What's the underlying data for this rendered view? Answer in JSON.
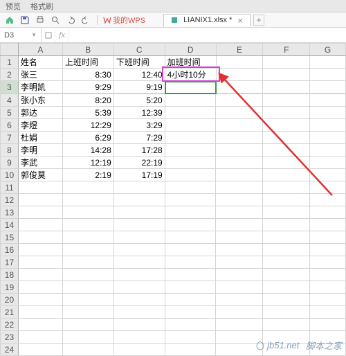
{
  "menubar": {
    "item1": "预览",
    "item2": "格式刷"
  },
  "wps": {
    "label": "我的WPS"
  },
  "file_tab": {
    "name": "LIANIX1.xlsx *"
  },
  "name_box": {
    "value": "D3"
  },
  "formula_input": {
    "value": ""
  },
  "columns": [
    "A",
    "B",
    "C",
    "D",
    "E",
    "F",
    "G"
  ],
  "header_row": {
    "a": "姓名",
    "b": "上班时间",
    "c": "下班时间",
    "d": "加班时间"
  },
  "rows": [
    {
      "n": "1"
    },
    {
      "n": "2",
      "a": "张三",
      "b": "8:30",
      "c": "12:40",
      "d": "4小时10分"
    },
    {
      "n": "3",
      "a": "李明凯",
      "b": "9:29",
      "c": "9:19"
    },
    {
      "n": "4",
      "a": "张小东",
      "b": "8:20",
      "c": "5:20"
    },
    {
      "n": "5",
      "a": "郭达",
      "b": "5:39",
      "c": "12:39"
    },
    {
      "n": "6",
      "a": "李煜",
      "b": "12:29",
      "c": "3:29"
    },
    {
      "n": "7",
      "a": "杜娟",
      "b": "6:29",
      "c": "7:29"
    },
    {
      "n": "8",
      "a": "李明",
      "b": "14:28",
      "c": "17:28"
    },
    {
      "n": "9",
      "a": "李武",
      "b": "12:19",
      "c": "22:19"
    },
    {
      "n": "10",
      "a": "郭俊莫",
      "b": "2:19",
      "c": "17:19"
    },
    {
      "n": "11"
    },
    {
      "n": "12"
    },
    {
      "n": "13"
    },
    {
      "n": "14"
    },
    {
      "n": "15"
    },
    {
      "n": "16"
    },
    {
      "n": "17"
    },
    {
      "n": "18"
    },
    {
      "n": "19"
    },
    {
      "n": "20"
    },
    {
      "n": "21"
    },
    {
      "n": "22"
    },
    {
      "n": "23"
    },
    {
      "n": "24"
    }
  ],
  "watermark": {
    "text": "脚本之家",
    "site": "jb51.net"
  }
}
